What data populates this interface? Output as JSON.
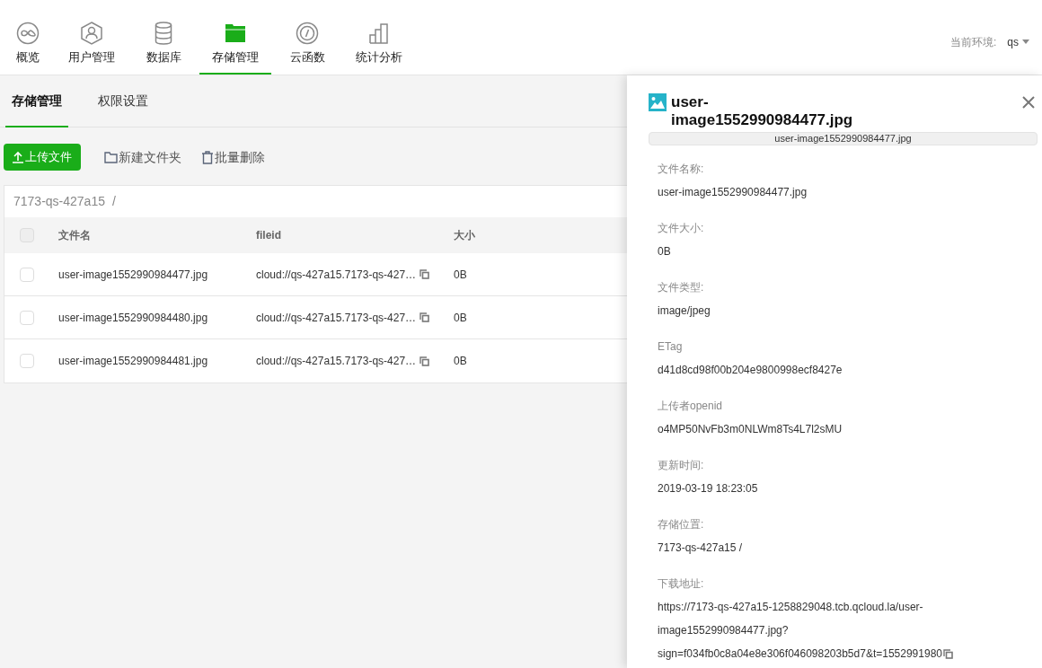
{
  "nav": {
    "items": [
      {
        "label": "概览",
        "kind": "overview",
        "selected": false
      },
      {
        "label": "用户管理",
        "kind": "user",
        "selected": false
      },
      {
        "label": "数据库",
        "kind": "database",
        "selected": false
      },
      {
        "label": "存储管理",
        "kind": "folder",
        "selected": true
      },
      {
        "label": "云函数",
        "kind": "function",
        "selected": false
      },
      {
        "label": "统计分析",
        "kind": "chart",
        "selected": false
      }
    ],
    "env_label": "当前环境:",
    "env_value": "qs"
  },
  "subtabs": [
    {
      "label": "存储管理",
      "selected": true
    },
    {
      "label": "权限设置",
      "selected": false
    }
  ],
  "toolbar": [
    {
      "label": "上传文件",
      "kind": "primary"
    },
    {
      "label": "新建文件夹",
      "kind": "folder"
    },
    {
      "label": "批量删除",
      "kind": "delete"
    }
  ],
  "table": {
    "all_checked": false,
    "breadcrumb": "7173-qs-427a15",
    "breadcrumb_sep": "/",
    "columns": [
      "文件名",
      "fileid",
      "大小"
    ],
    "rows": [
      {
        "checked": false,
        "name": "user-image1552990984477.jpg",
        "fileid": "cloud://qs-427a15.7173-qs-427…",
        "size": "0B"
      },
      {
        "checked": false,
        "name": "user-image1552990984480.jpg",
        "fileid": "cloud://qs-427a15.7173-qs-427…",
        "size": "0B"
      },
      {
        "checked": false,
        "name": "user-image1552990984481.jpg",
        "fileid": "cloud://qs-427a15.7173-qs-427…",
        "size": "0B"
      }
    ]
  },
  "drawer": {
    "title": "user-image1552990984477.jpg",
    "preview_label": "user-image1552990984477.jpg",
    "fields": [
      {
        "label": "文件名称:",
        "value": "user-image1552990984477.jpg"
      },
      {
        "label": "文件大小:",
        "value": "0B"
      },
      {
        "label": "文件类型:",
        "value": "image/jpeg"
      },
      {
        "label": "ETag",
        "value": "d41d8cd98f00b204e9800998ecf8427e"
      },
      {
        "label": "上传者openid",
        "value": "o4MP50NvFb3m0NLWm8Ts4L7l2sMU"
      },
      {
        "label": "更新时间:",
        "value": "2019-03-19 18:23:05"
      },
      {
        "label": "存储位置:",
        "value": "7173-qs-427a15 /"
      },
      {
        "label": "下载地址:",
        "value": "https://7173-qs-427a15-1258829048.tcb.qcloud.la/user-image1552990984477.jpg?sign=f034fb0c8a04e8e306f046098203b5d7&t=1552991980",
        "copy": true
      }
    ]
  }
}
